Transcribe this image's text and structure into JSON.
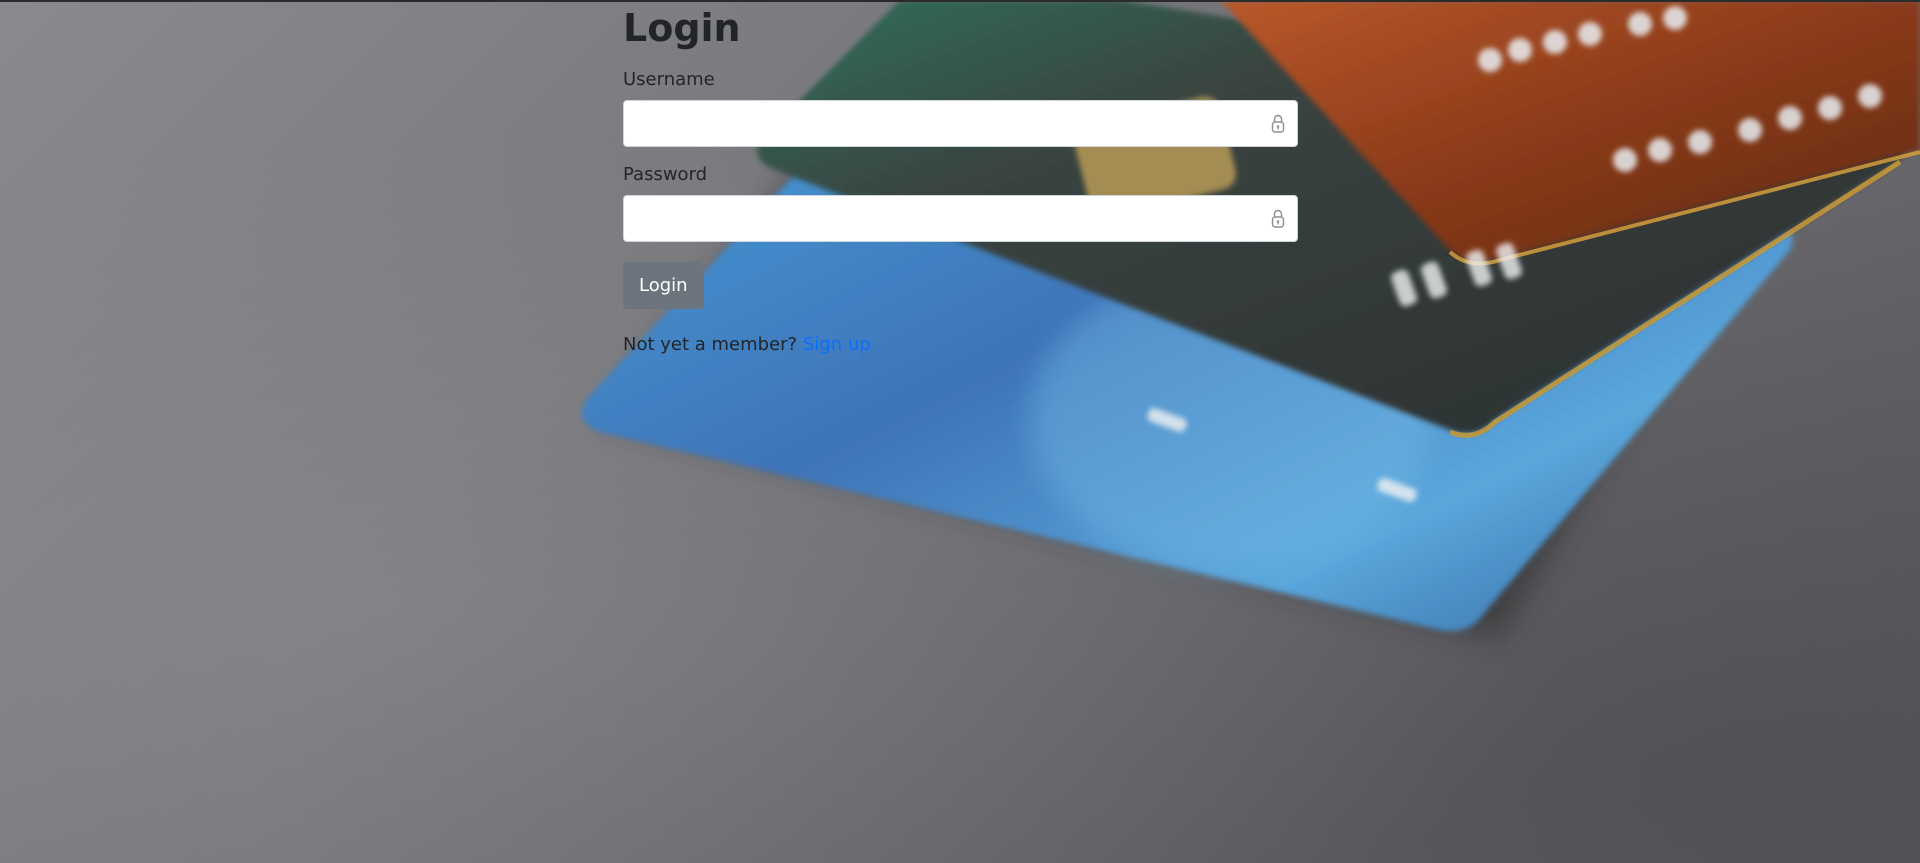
{
  "login": {
    "title": "Login",
    "username_label": "Username",
    "username_value": "",
    "password_label": "Password",
    "password_value": "",
    "submit_label": "Login",
    "signup_prompt": "Not yet a member?",
    "signup_link": "Sign up"
  },
  "icons": {
    "username_field_icon": "lock-icon",
    "password_field_icon": "lock-icon"
  },
  "colors": {
    "button_bg": "#6c757d",
    "link": "#0d6efd",
    "text": "#212529",
    "input_border": "#ced4da"
  }
}
